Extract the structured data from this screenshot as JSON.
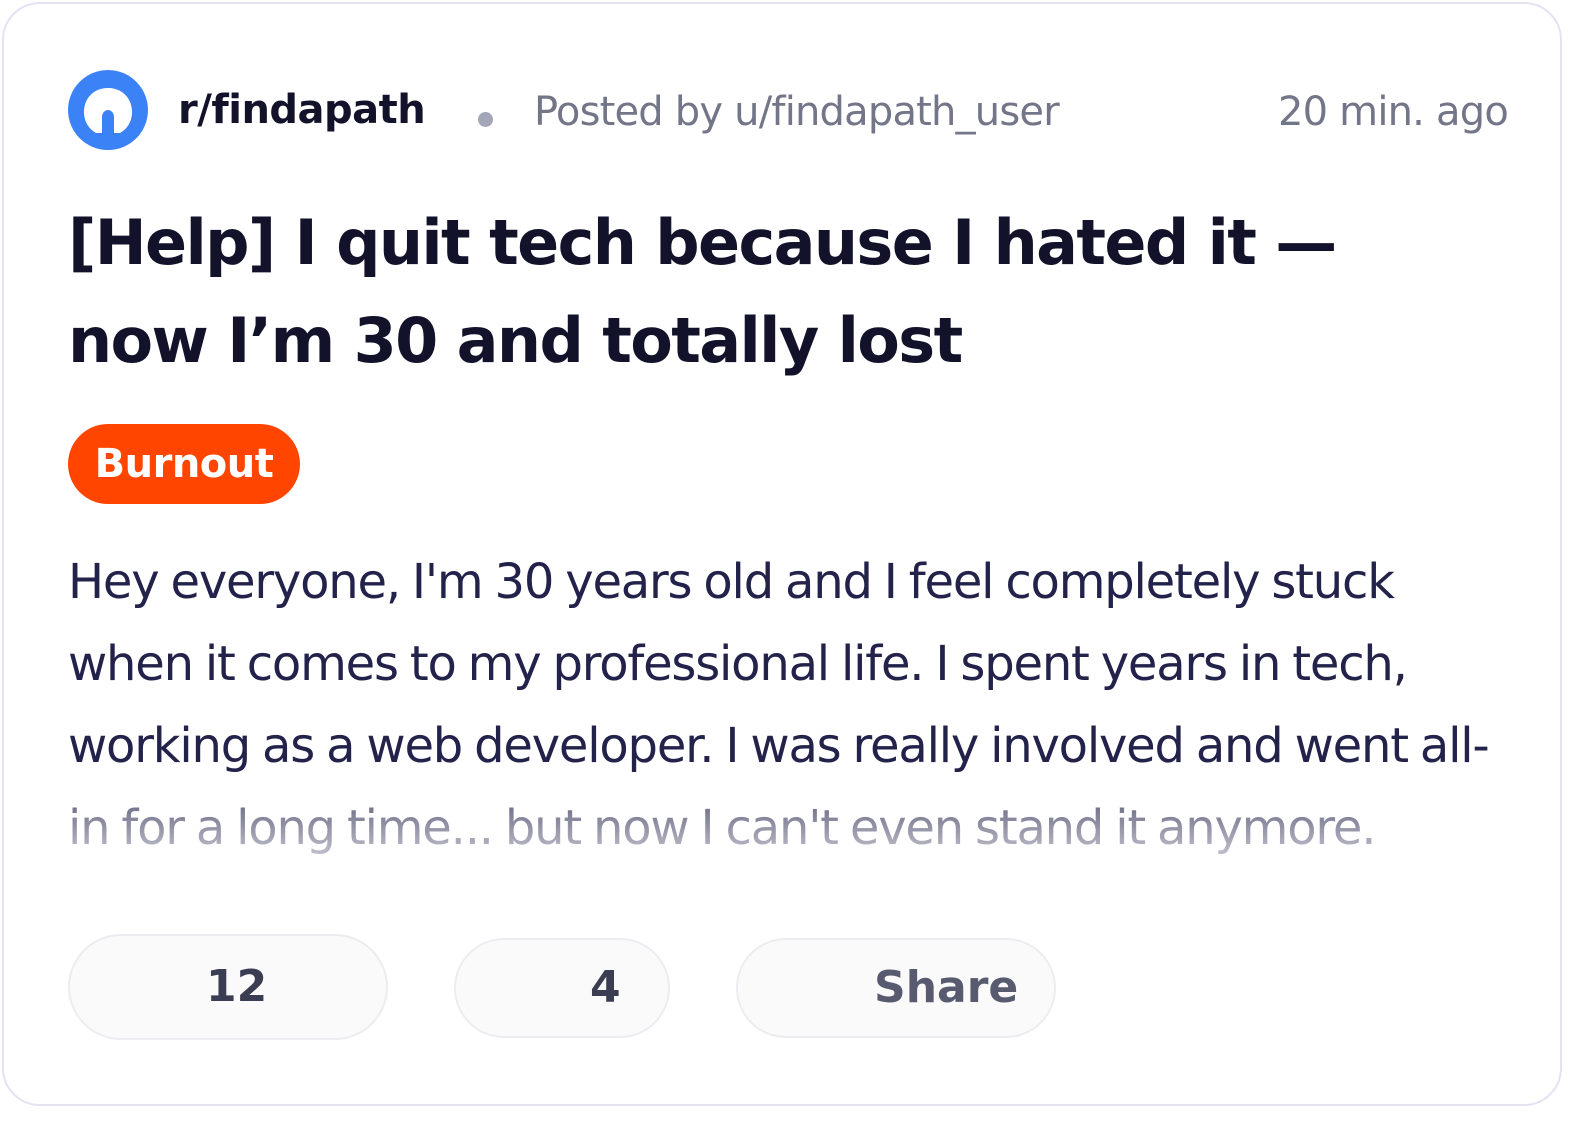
{
  "colors": {
    "subreddit_avatar": "#3b82f6",
    "tag_background": "#ff4500",
    "tag_text": "#ffffff",
    "title_text": "#12122b",
    "meta_text": "#737588",
    "card_border": "#e3e3f3"
  },
  "post": {
    "subreddit": "r/findapath",
    "subreddit_icon": "subreddit-avatar-icon",
    "posted_by": "Posted by u/findapath_user",
    "time_ago": "20 min. ago",
    "title": "[Help] I quit tech because I hated it — now I’m 30 and totally lost",
    "tag": "Burnout",
    "body": "Hey everyone, I'm 30 years old and I feel completely stuck when it comes to my professional life. I spent years in tech, working as a web developer. I was really involved and went all-in for a long time... but now I can't even stand it anymore."
  },
  "actions": {
    "votes": "12",
    "comments": "4",
    "share": "Share"
  }
}
